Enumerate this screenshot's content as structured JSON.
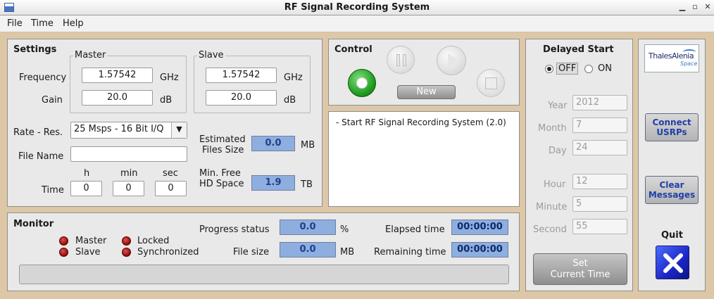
{
  "window": {
    "title": "RF Signal Recording System"
  },
  "menu": [
    "File",
    "Time",
    "Help"
  ],
  "settings": {
    "title": "Settings",
    "master": {
      "legend": "Master",
      "frequency": "1.57542",
      "gain": "20.0"
    },
    "slave": {
      "legend": "Slave",
      "frequency": "1.57542",
      "gain": "20.0"
    },
    "frequency_label": "Frequency",
    "gain_label": "Gain",
    "ghz_unit": "GHz",
    "db_unit": "dB",
    "rate_label": "Rate - Res.",
    "rate_value": "25 Msps - 16 Bit I/Q",
    "file_name_label": "File Name",
    "file_name_value": "",
    "time_label": "Time",
    "h_label": "h",
    "min_label": "min",
    "sec_label": "sec",
    "h_value": "0",
    "min_value": "0",
    "sec_value": "0",
    "est_size_label_1": "Estimated",
    "est_size_label_2": "Files Size",
    "est_size_value": "0.0",
    "est_size_unit": "MB",
    "min_free_label_1": "Min. Free",
    "min_free_label_2": "HD Space",
    "min_free_value": "1.9",
    "min_free_unit": "TB"
  },
  "control": {
    "title": "Control",
    "new_label": "New"
  },
  "messages": [
    "- Start RF Signal Recording System (2.0)"
  ],
  "delayed": {
    "title": "Delayed Start",
    "off_label": "OFF",
    "on_label": "ON",
    "selected": "OFF",
    "year_label": "Year",
    "year": "2012",
    "month_label": "Month",
    "month": "7",
    "day_label": "Day",
    "day": "24",
    "hour_label": "Hour",
    "hour": "12",
    "minute_label": "Minute",
    "minute": "5",
    "second_label": "Second",
    "second": "55",
    "set_time_1": "Set",
    "set_time_2": "Current Time"
  },
  "monitor": {
    "title": "Monitor",
    "master_label": "Master",
    "slave_label": "Slave",
    "locked_label": "Locked",
    "synchronized_label": "Synchronized",
    "progress_label": "Progress status",
    "progress_value": "0.0",
    "progress_unit": "%",
    "file_size_label": "File size",
    "file_size_value": "0.0",
    "file_size_unit": "MB",
    "elapsed_label": "Elapsed time",
    "elapsed_value": "00:00:00",
    "remaining_label": "Remaining time",
    "remaining_value": "00:00:00",
    "progress_fraction": 0.0
  },
  "sidebar": {
    "logo_text_1": "ThalesAlenia",
    "logo_text_2": "Space",
    "connect_1": "Connect",
    "connect_2": "USRPs",
    "clear_1": "Clear",
    "clear_2": "Messages",
    "quit_label": "Quit"
  }
}
